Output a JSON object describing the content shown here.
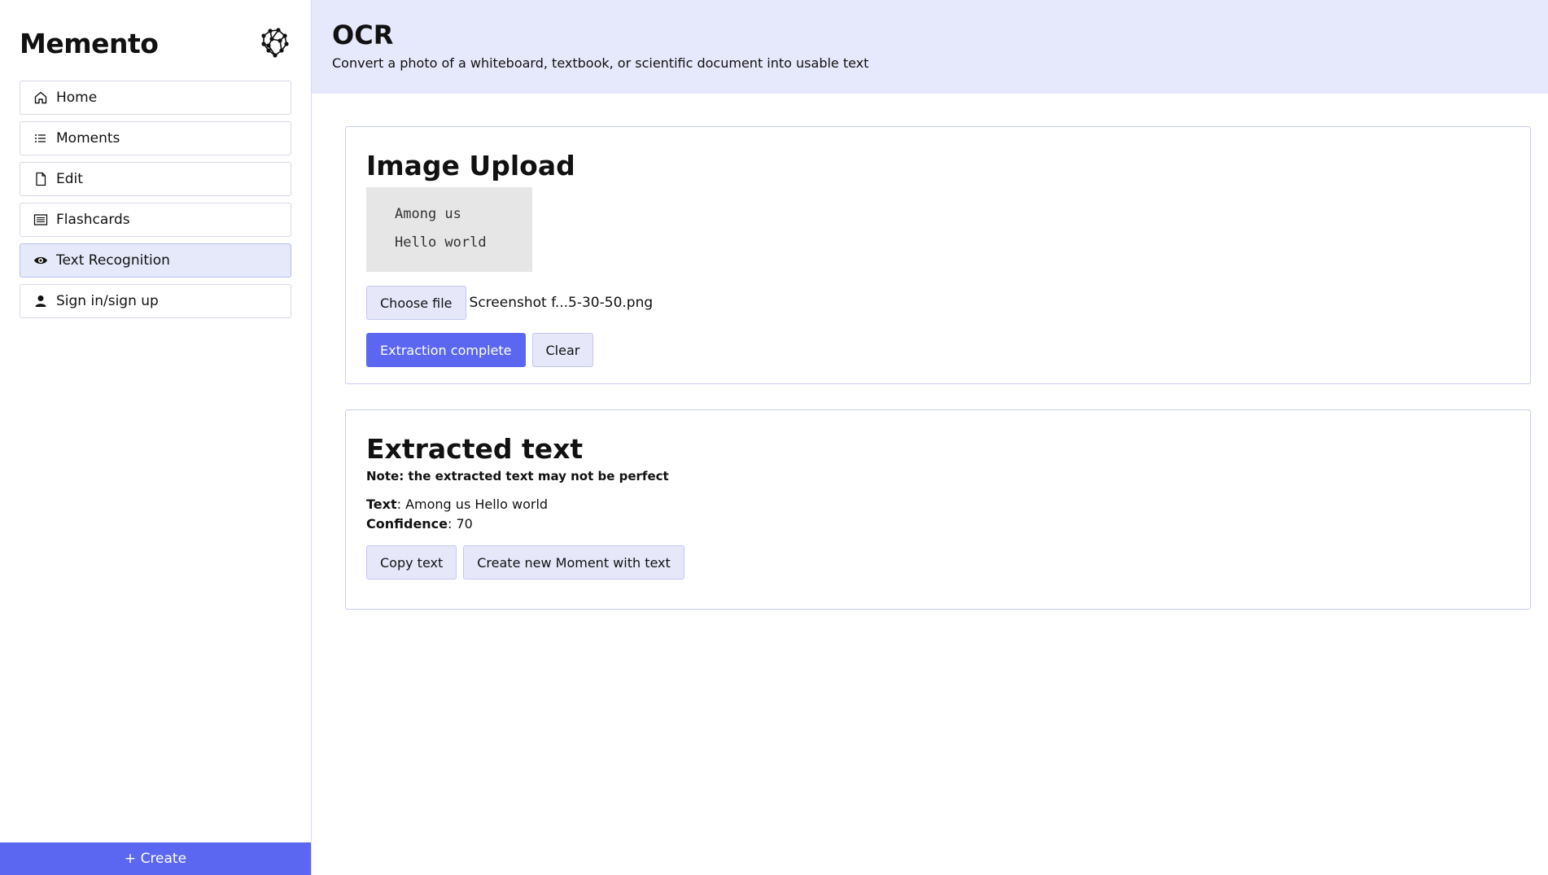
{
  "sidebar": {
    "brand": "Memento",
    "logo_icon": "network-brain-icon",
    "items": [
      {
        "label": "Home",
        "icon": "home-icon",
        "active": false
      },
      {
        "label": "Moments",
        "icon": "list-icon",
        "active": false
      },
      {
        "label": "Edit",
        "icon": "file-icon",
        "active": false
      },
      {
        "label": "Flashcards",
        "icon": "cards-icon",
        "active": false
      },
      {
        "label": "Text Recognition",
        "icon": "eye-icon",
        "active": true
      },
      {
        "label": "Sign in/sign up",
        "icon": "user-icon",
        "active": false
      }
    ],
    "create_label": "+ Create"
  },
  "header": {
    "title": "OCR",
    "subtitle": "Convert a photo of a whiteboard, textbook, or scientific document into usable text"
  },
  "upload": {
    "title": "Image Upload",
    "preview_lines": [
      "Among us",
      "Hello world"
    ],
    "choose_label": "Choose file",
    "file_name": "Screenshot f...5-30-50.png",
    "extract_label": "Extraction complete",
    "clear_label": "Clear"
  },
  "result": {
    "title": "Extracted text",
    "note": "Note: the extracted text may not be perfect",
    "text_label": "Text",
    "text_value": "Among us Hello world",
    "confidence_label": "Confidence",
    "confidence_value": "70",
    "copy_label": "Copy text",
    "create_moment_label": "Create new Moment with text"
  },
  "colors": {
    "accent": "#5b67f0",
    "header_bg": "#e6e8fb",
    "active_item_bg": "#e6e9fa"
  }
}
